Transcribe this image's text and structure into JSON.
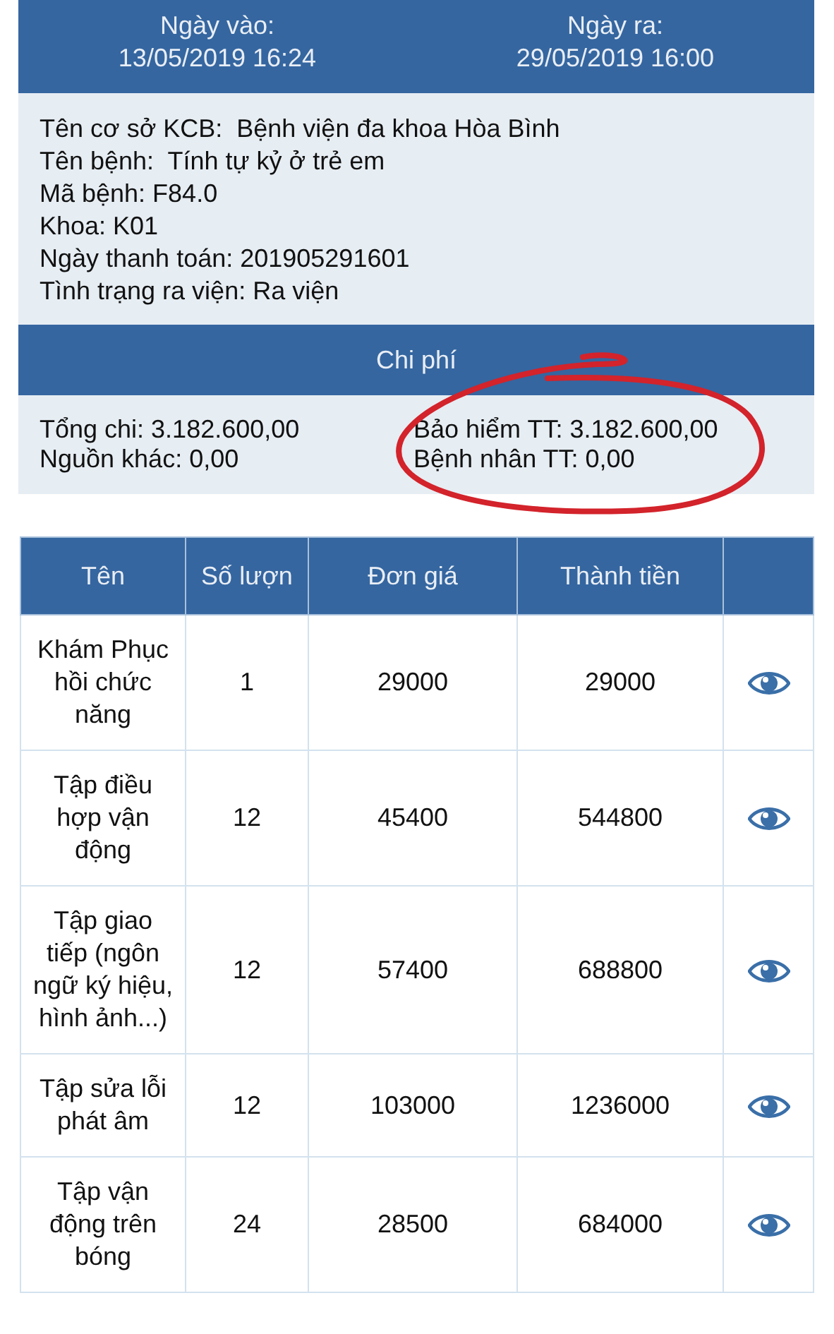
{
  "dates": [
    {
      "label": "Ngày vào:",
      "value": "13/05/2019 16:24"
    },
    {
      "label": "Ngày ra:",
      "value": "29/05/2019 16:00"
    }
  ],
  "info": [
    "Tên cơ sở KCB:  Bệnh viện đa khoa Hòa Bình",
    "Tên bệnh:  Tính tự kỷ ở trẻ em",
    "Mã bệnh: F84.0",
    "Khoa: K01",
    "Ngày thanh toán: 201905291601",
    "Tình trạng ra viện: Ra viện"
  ],
  "costs": {
    "title": "Chi phí",
    "left": [
      "Tổng chi: 3.182.600,00",
      "Nguồn khác: 0,00"
    ],
    "right": [
      "Bảo hiểm TT: 3.182.600,00",
      "Bệnh nhân TT: 0,00"
    ],
    "right_circled": true
  },
  "table": {
    "columns": [
      "Tên",
      "Số lượn",
      "Đơn giá",
      "Thành tiền"
    ],
    "rows": [
      [
        "Khám Phục hồi chức năng",
        "1",
        "29000",
        "29000"
      ],
      [
        "Tập điều hợp vận động",
        "12",
        "45400",
        "544800"
      ],
      [
        "Tập giao tiếp (ngôn ngữ ký hiệu, hình ảnh...)",
        "12",
        "57400",
        "688800"
      ],
      [
        "Tập sửa lỗi phát âm",
        "12",
        "103000",
        "1236000"
      ],
      [
        "Tập vận động trên bóng",
        "24",
        "28500",
        "684000"
      ]
    ]
  }
}
